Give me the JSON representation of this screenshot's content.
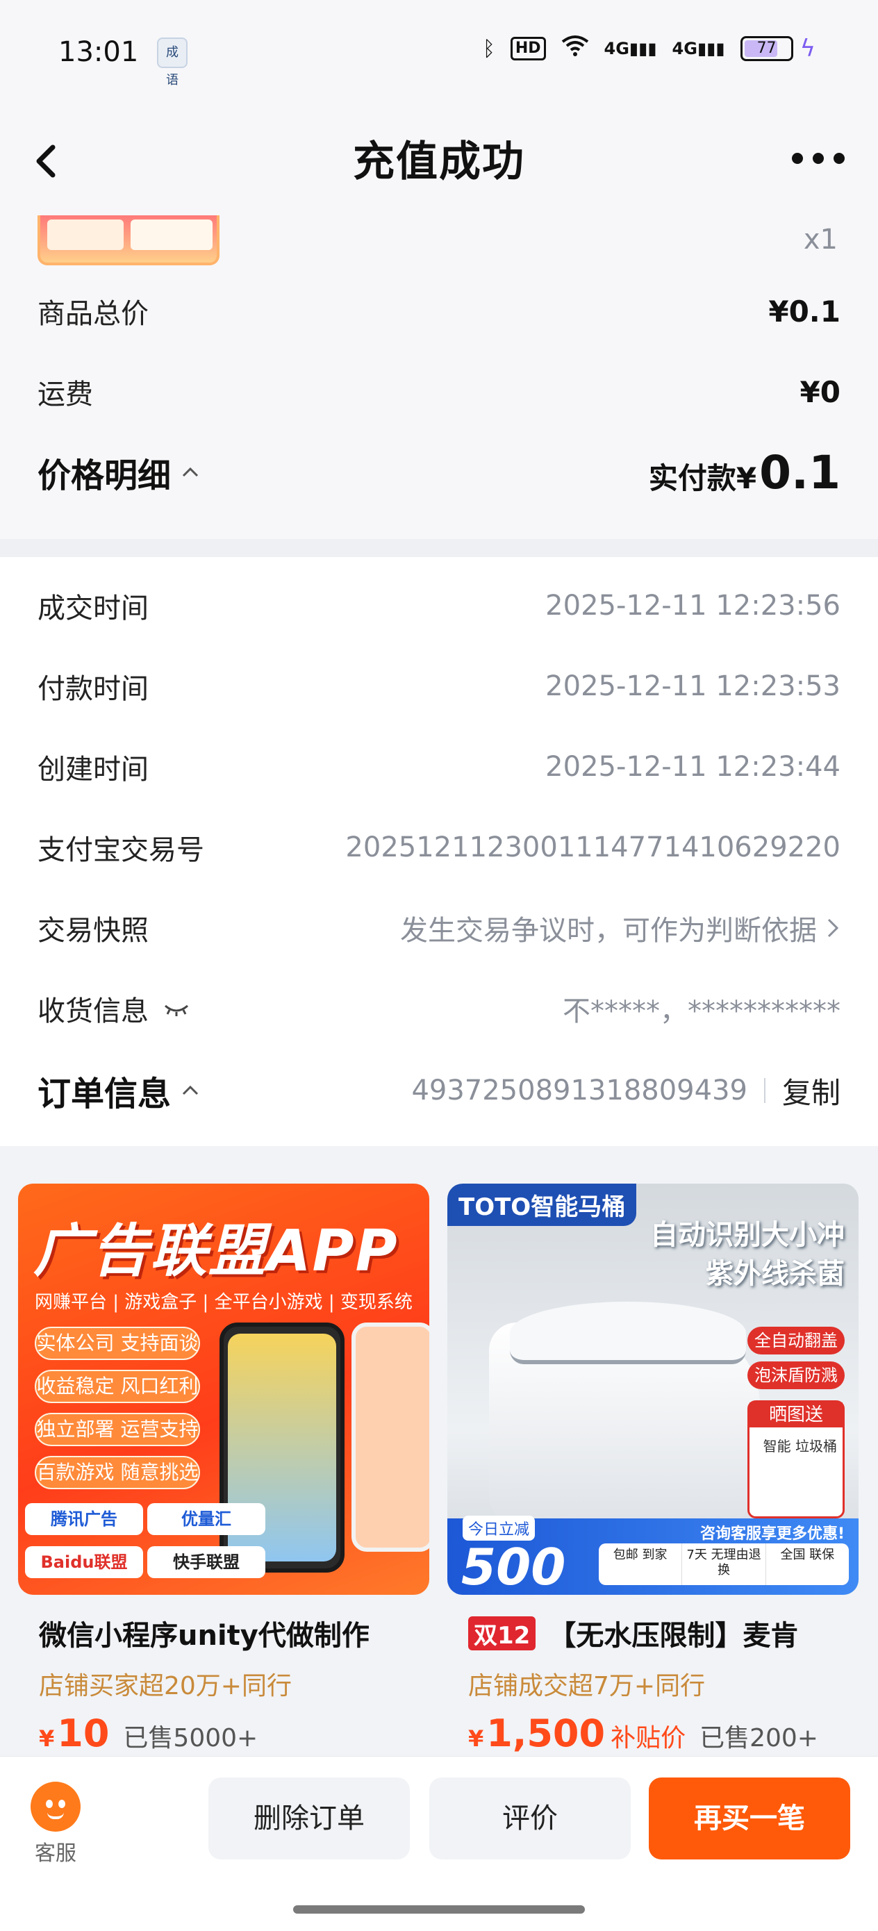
{
  "status_bar": {
    "time": "13:01",
    "app_icon_text": "成 语",
    "hd_label": "HD",
    "signal1": "4G",
    "signal2": "4G",
    "battery": "77",
    "battery_level": 0.77
  },
  "nav": {
    "title": "充值成功"
  },
  "product": {
    "quantity": "x1"
  },
  "price_rows": [
    {
      "label": "商品总价",
      "value": "¥0.1"
    },
    {
      "label": "运费",
      "value": "¥0"
    }
  ],
  "price_detail": {
    "title": "价格明细",
    "paid_label": "实付款¥",
    "paid_amount": "0.1"
  },
  "info_rows": {
    "deal_time": {
      "label": "成交时间",
      "value": "2025-12-11 12:23:56"
    },
    "pay_time": {
      "label": "付款时间",
      "value": "2025-12-11 12:23:53"
    },
    "create_time": {
      "label": "创建时间",
      "value": "2025-12-11 12:23:44"
    },
    "alipay_no": {
      "label": "支付宝交易号",
      "value": "2025121123001114771410629220"
    },
    "snapshot": {
      "label": "交易快照",
      "value": "发生交易争议时，可作为判断依据"
    },
    "delivery": {
      "label": "收货信息",
      "value": "不*****，***********"
    }
  },
  "order_info": {
    "title": "订单信息",
    "order_no": "4937250891318809439",
    "copy": "复制"
  },
  "feed": {
    "left": {
      "ad_headline": "广告联盟APP",
      "ad_sub": "网赚平台 | 游戏盒子 | 全平台小游戏 | 变现系统",
      "ad_chips": [
        "实体公司 支持面谈",
        "收益稳定 风口红利",
        "独立部署 运营支持",
        "百款游戏 随意挑选"
      ],
      "ad_logos": [
        "腾讯广告",
        "优量汇",
        "Baidu联盟",
        "快手联盟"
      ],
      "title": "微信小程序unity代做制作",
      "shop": "店铺买家超20万+同行",
      "price_symbol": "¥",
      "price": "10",
      "sold": "已售5000+"
    },
    "right": {
      "brand_badge": "TOTO智能马桶",
      "headline_1": "自动识别大小冲",
      "headline_2": "紫外线杀菌",
      "tag_1": "全自动翻盖",
      "tag_2": "泡沫盾防溅",
      "gift_label": "晒图送",
      "gift_text": "智能 垃圾桶",
      "today_label": "今日立减",
      "today_amount": "500",
      "consult": "咨询客服享更多优惠!",
      "strip": [
        "包邮 到家",
        "7天 无理由退换",
        "全国 联保"
      ],
      "badge": "双12",
      "title": "【无水压限制】麦肯",
      "shop": "店铺成交超7万+同行",
      "price_symbol": "¥",
      "price": "1,500",
      "price_tag": "补贴价",
      "sold": "已售200+"
    }
  },
  "bottom": {
    "service_label": "客服",
    "delete": "删除订单",
    "review": "评价",
    "rebuy": "再买一笔"
  }
}
